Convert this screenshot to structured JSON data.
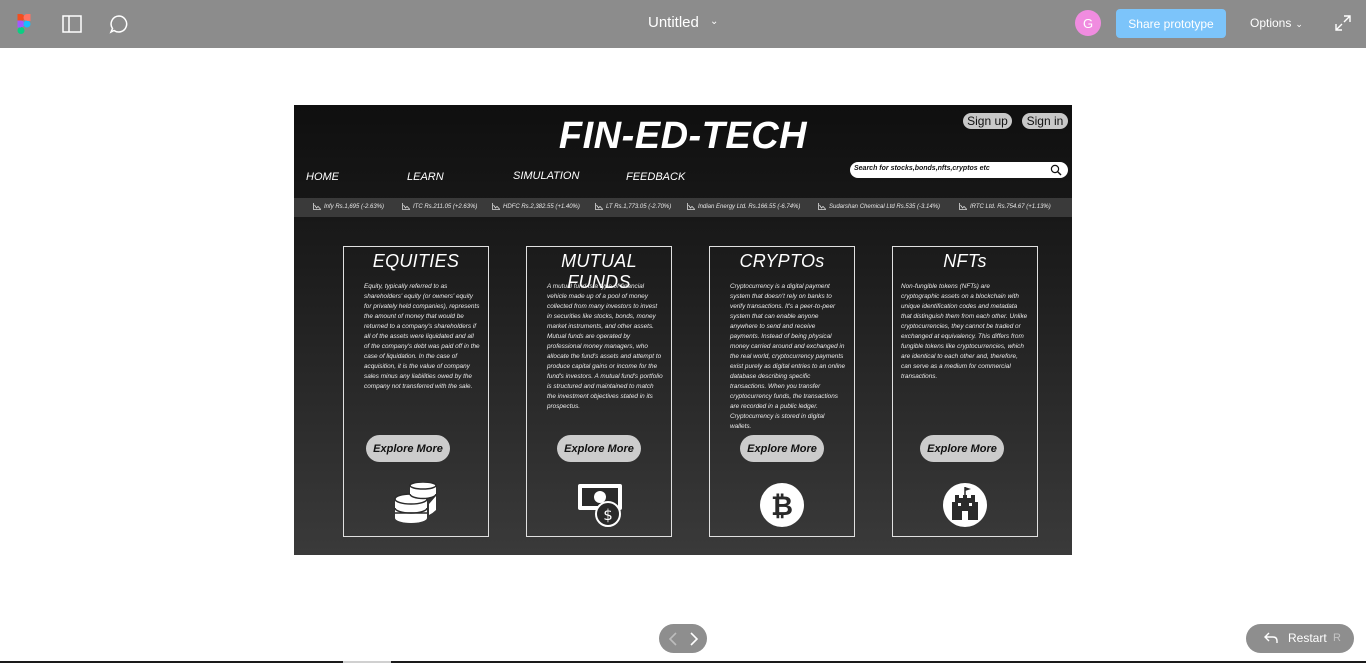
{
  "toolbar": {
    "title": "Untitled",
    "avatar_initial": "G",
    "share_label": "Share prototype",
    "options_label": "Options"
  },
  "site": {
    "brand": "FIN-ED-TECH",
    "signup": "Sign up",
    "signin": "Sign in",
    "nav": [
      "HOME",
      "LEARN",
      "SIMULATION",
      "FEEDBACK"
    ],
    "search_placeholder": "Search for stocks,bonds,nfts,cryptos etc",
    "ticker": [
      "Infy Rs.1,695 (-2.63%)",
      "ITC Rs.211.05 (+2.63%)",
      "HDFC Rs.2,382.55 (+1.40%)",
      "LT Rs.1,773.05 (-2.70%)",
      "Indian Energy Ltd. Rs.166.55 (-6.74%)",
      "Sudarshan Chemical Ltd Rs.535 (-3.14%)",
      "IRTC Ltd. Rs.754.67 (+1.13%)"
    ],
    "cards": [
      {
        "title": "EQUITIES",
        "text": "Equity, typically referred to as shareholders' equity (or owners' equity for privately held companies), represents the amount of money that would be returned to a company's shareholders if all of the assets were liquidated and all of the company's debt was paid off in the case of liquidation. In the case of acquisition, it is the value of company sales minus any liabilities owed by the company not transferred with the sale.",
        "button": "Explore More",
        "icon": "coins-icon"
      },
      {
        "title": "MUTUAL FUNDS",
        "text": "A mutual fund is a type of financial vehicle made up of a pool of money collected from many investors to invest in securities like stocks, bonds, money market instruments, and other assets. Mutual funds are operated by professional money managers, who allocate the fund's assets and attempt to produce capital gains or income for the fund's investors. A mutual fund's portfolio is structured and maintained to match the investment objectives stated in its prospectus.",
        "button": "Explore More",
        "icon": "money-icon"
      },
      {
        "title": "CRYPTOs",
        "text": "Cryptocurrency is a digital payment system that doesn't rely on banks to verify transactions. It's a peer-to-peer system that can enable anyone anywhere to send and receive payments. Instead of being physical money carried around and exchanged in the real world, cryptocurrency payments exist purely as digital entries to an online database describing specific transactions. When you transfer cryptocurrency funds, the transactions are recorded in a public ledger. Cryptocurrency is stored in digital wallets.",
        "button": "Explore More",
        "icon": "bitcoin-icon"
      },
      {
        "title": "NFTs",
        "text": "Non-fungible tokens (NFTs) are cryptographic assets on a blockchain with unique identification codes and metadata that distinguish them from each other. Unlike cryptocurrencies, they cannot be traded or exchanged at equivalency. This differs from fungible tokens like cryptocurrencies, which are identical to each other and, therefore, can serve as a medium for commercial transactions.",
        "button": "Explore More",
        "icon": "castle-icon"
      }
    ]
  },
  "controls": {
    "restart_label": "Restart",
    "restart_key": "R"
  }
}
